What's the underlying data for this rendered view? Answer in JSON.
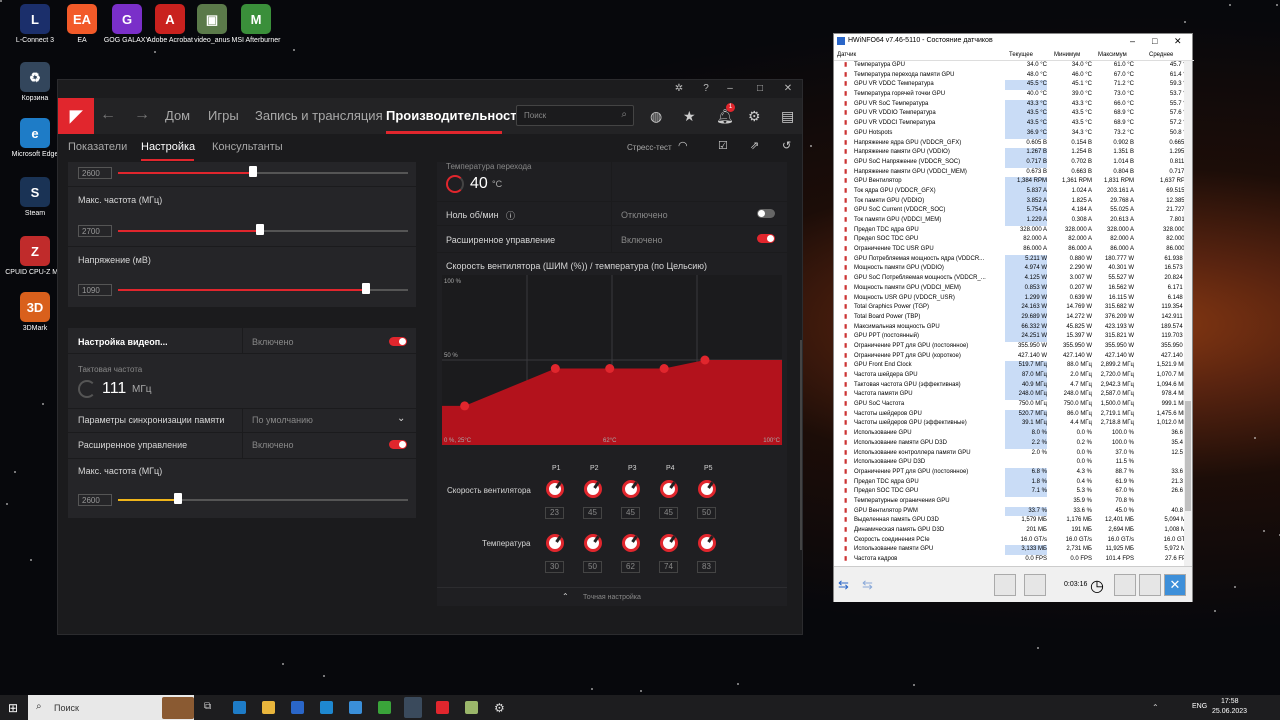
{
  "desktop": {
    "icons": [
      {
        "label": "L-Connect 3",
        "color": "#1b2f6b",
        "glyph": "L"
      },
      {
        "label": "EA",
        "color": "#f25a29",
        "glyph": "EA"
      },
      {
        "label": "GOG GALAXY",
        "color": "#7a2fc9",
        "glyph": "G"
      },
      {
        "label": "Adobe Acrobat",
        "color": "#c9211e",
        "glyph": "A"
      },
      {
        "label": "video_anus",
        "color": "#5b7a4a",
        "glyph": "▣"
      },
      {
        "label": "MSI Afterburner",
        "color": "#3a8f3a",
        "glyph": "M"
      },
      {
        "label": "Корзина",
        "color": "#33465c",
        "glyph": "♻"
      },
      {
        "label": "Microsoft Edge",
        "color": "#1e7cc7",
        "glyph": "e"
      },
      {
        "label": "Steam",
        "color": "#1a3355",
        "glyph": "S"
      },
      {
        "label": "CPUID CPU-Z MSI",
        "color": "#c02b2b",
        "glyph": "Z"
      },
      {
        "label": "3DMark",
        "color": "#d9601c",
        "glyph": "3D"
      }
    ]
  },
  "amd": {
    "nav": {
      "home": "Дом",
      "games": "Игры",
      "record": "Запись и трансляция",
      "performance": "Производительность",
      "search_placeholder": "Поиск",
      "notif_count": "1"
    },
    "subnav": {
      "metrics": "Показатели",
      "tuning": "Настройка",
      "advisors": "Консультанты",
      "stress": "Стресс-тест"
    },
    "gpu": {
      "freq_min_value": "2600",
      "max_freq_label": "Макс. частота (МГц)",
      "max_freq_value": "2700",
      "voltage_label": "Напряжение (мВ)",
      "voltage_value": "1090"
    },
    "vram": {
      "title": "Настройка видеоп...",
      "title_state": "Включено",
      "clock_label": "Тактовая частота",
      "clock_value": "111",
      "clock_unit": "МГц",
      "mem_timing_label": "Параметры синхронизации памяти",
      "mem_timing_value": "По умолчанию",
      "advanced_label": "Расширенное управление",
      "advanced_state": "Включено",
      "max_freq_label": "Макс. частота (МГц)",
      "max_freq_value": "2600"
    },
    "fan": {
      "junction_label": "Температура перехода",
      "junction_value": "40",
      "junction_unit": "°C",
      "zero_rpm_label": "Ноль об/мин",
      "zero_rpm_state": "Отключено",
      "advanced_label": "Расширенное управление",
      "advanced_state": "Включено",
      "curve_title": "Скорость вентилятора (ШИМ (%)) / температура (по Цельсию)",
      "axis_top": "100 %",
      "axis_mid": "50 %",
      "axis_origin": "0 %, 25°C",
      "axis_mid_x": "62°C",
      "axis_end": "100°C",
      "speed_label": "Скорость вентилятора",
      "temp_label": "Температура",
      "fine_tune": "Точная настройка",
      "points": [
        {
          "p": "P1",
          "speed": "23",
          "temp": "30"
        },
        {
          "p": "P2",
          "speed": "45",
          "temp": "50"
        },
        {
          "p": "P3",
          "speed": "45",
          "temp": "62"
        },
        {
          "p": "P4",
          "speed": "45",
          "temp": "74"
        },
        {
          "p": "P5",
          "speed": "50",
          "temp": "83"
        }
      ]
    }
  },
  "hwinfo": {
    "title": "HWiNFO64 v7.46-5110 - Состояние датчиков",
    "cols": [
      "Датчик",
      "Текущее",
      "Минимум",
      "Максимум",
      "Среднее"
    ],
    "elapsed": "0:03:16",
    "rows": [
      [
        "Температура GPU",
        "34.0 °C",
        "34.0 °C",
        "61.0 °C",
        "45.7 °C",
        0
      ],
      [
        "Температура перехода памяти GPU",
        "48.0 °C",
        "46.0 °C",
        "67.0 °C",
        "61.4 °C",
        0
      ],
      [
        "GPU VR VDDC Температура",
        "45.5 °C",
        "45.1 °C",
        "71.2 °C",
        "59.3 °C",
        1
      ],
      [
        "Температура горячей точки GPU",
        "40.0 °C",
        "39.0 °C",
        "73.0 °C",
        "53.7 °C",
        0
      ],
      [
        "GPU VR SoC Температура",
        "43.3 °C",
        "43.3 °C",
        "66.0 °C",
        "55.7 °C",
        1
      ],
      [
        "GPU VR VDDIO Температура",
        "43.5 °C",
        "43.5 °C",
        "68.9 °C",
        "57.6 °C",
        1
      ],
      [
        "GPU VR VDDCI Температура",
        "43.5 °C",
        "43.5 °C",
        "68.9 °C",
        "57.2 °C",
        1
      ],
      [
        "GPU Hotspots",
        "36.9 °C",
        "34.3 °C",
        "73.2 °C",
        "50.8 °C",
        1
      ],
      [
        "Напряжение ядра GPU (VDDCR_GFX)",
        "0.605 В",
        "0.154 В",
        "0.902 В",
        "0.665 В",
        0
      ],
      [
        "Напряжение памяти GPU (VDDIO)",
        "1.267 В",
        "1.254 В",
        "1.351 В",
        "1.295 В",
        1
      ],
      [
        "GPU SoC Напряжение (VDDCR_SOC)",
        "0.717 В",
        "0.702 В",
        "1.014 В",
        "0.811 В",
        1
      ],
      [
        "Напряжение памяти GPU (VDDCI_MEM)",
        "0.673 В",
        "0.663 В",
        "0.804 В",
        "0.717 В",
        0
      ],
      [
        "GPU Вентилятор",
        "1,384 RPM",
        "1,361 RPM",
        "1,831 RPM",
        "1,637 RPM",
        1
      ],
      [
        "Ток ядра GPU (VDDCR_GFX)",
        "5.837 A",
        "1.024 A",
        "203.161 A",
        "69.515 A",
        1
      ],
      [
        "Ток памяти GPU (VDDIO)",
        "3.852 A",
        "1.825 A",
        "29.768 A",
        "12.385 A",
        1
      ],
      [
        "GPU SoC Current (VDDCR_SOC)",
        "5.754 A",
        "4.184 A",
        "55.025 A",
        "21.727 A",
        1
      ],
      [
        "Ток памяти GPU (VDDCI_MEM)",
        "1.229 A",
        "0.308 A",
        "20.613 A",
        "7.801 A",
        1
      ],
      [
        "Предел TDC ядра GPU",
        "328.000 A",
        "328.000 A",
        "328.000 A",
        "328.000 A",
        0
      ],
      [
        "Предел SOC TDC GPU",
        "82.000 A",
        "82.000 A",
        "82.000 A",
        "82.000 A",
        0
      ],
      [
        "Ограничение TDC USR GPU",
        "86.000 A",
        "86.000 A",
        "86.000 A",
        "86.000 A",
        0
      ],
      [
        "GPU Потребляемая мощность ядра (VDDCR...",
        "5.211 W",
        "0.880 W",
        "180.777 W",
        "61.938 W",
        1
      ],
      [
        "Мощность памяти GPU (VDDIO)",
        "4.974 W",
        "2.290 W",
        "40.301 W",
        "16.573 W",
        1
      ],
      [
        "GPU SoC Потребляемая мощность (VDDCR_...",
        "4.125 W",
        "3.007 W",
        "55.527 W",
        "20.824 W",
        1
      ],
      [
        "Мощность памяти GPU (VDDCI_MEM)",
        "0.853 W",
        "0.207 W",
        "16.562 W",
        "6.171 W",
        1
      ],
      [
        "Мощность USR GPU (VDDCR_USR)",
        "1.299 W",
        "0.639 W",
        "16.115 W",
        "6.148 W",
        1
      ],
      [
        "Total Graphics Power (TGP)",
        "24.163 W",
        "14.769 W",
        "315.682 W",
        "119.354 W",
        1
      ],
      [
        "Total Board Power (TBP)",
        "29.689 W",
        "14.272 W",
        "376.209 W",
        "142.911 W",
        1
      ],
      [
        "Максимальная мощность GPU",
        "66.332 W",
        "45.825 W",
        "423.193 W",
        "189.574 W",
        1
      ],
      [
        "GPU PPT (постоянный)",
        "24.251 W",
        "15.397 W",
        "315.821 W",
        "119.703 W",
        1
      ],
      [
        "Ограничение PPT для GPU (постоянное)",
        "355.950 W",
        "355.950 W",
        "355.950 W",
        "355.950 W",
        0
      ],
      [
        "Ограничение PPT для GPU (короткое)",
        "427.140 W",
        "427.140 W",
        "427.140 W",
        "427.140 W",
        0
      ],
      [
        "GPU Front End Clock",
        "519.7 МГц",
        "88.0 МГц",
        "2,899.2 МГц",
        "1,521.9 МГц",
        1
      ],
      [
        "Частота шейдера GPU",
        "87.0 МГц",
        "2.0 МГц",
        "2,720.0 МГц",
        "1,070.7 МГц",
        1
      ],
      [
        "Тактовая частота GPU (эффективная)",
        "40.9 МГц",
        "4.7 МГц",
        "2,942.3 МГц",
        "1,094.6 МГц",
        1
      ],
      [
        "Частота памяти GPU",
        "248.0 МГц",
        "248.0 МГц",
        "2,587.0 МГц",
        "978.4 МГц",
        1
      ],
      [
        "GPU SoC Частота",
        "750.0 МГц",
        "750.0 МГц",
        "1,500.0 МГц",
        "999.1 МГц",
        0
      ],
      [
        "Частоты шейдеров GPU",
        "520.7 МГц",
        "86.0 МГц",
        "2,719.1 МГц",
        "1,475.6 МГц",
        1
      ],
      [
        "Частоты шейдеров GPU (эффективные)",
        "39.1 МГц",
        "4.4 МГц",
        "2,718.8 МГц",
        "1,012.0 МГц",
        1
      ],
      [
        "Использование GPU",
        "8.0 %",
        "0.0 %",
        "100.0 %",
        "36.6 %",
        1
      ],
      [
        "Использование памяти GPU D3D",
        "2.2 %",
        "0.2 %",
        "100.0 %",
        "35.4 %",
        1
      ],
      [
        "Использование контроллера памяти GPU",
        "2.0 %",
        "0.0 %",
        "37.0 %",
        "12.5 %",
        0
      ],
      [
        "Использование GPU D3D",
        "",
        "0.0 %",
        "11.5 %",
        "",
        0
      ],
      [
        "Ограничение PPT для GPU (постоянное)",
        "6.8 %",
        "4.3 %",
        "88.7 %",
        "33.6 %",
        1
      ],
      [
        "Предел TDC ядра GPU",
        "1.8 %",
        "0.4 %",
        "61.9 %",
        "21.3 %",
        1
      ],
      [
        "Предел SOC TDC GPU",
        "7.1 %",
        "5.3 %",
        "67.0 %",
        "26.6 %",
        1
      ],
      [
        "Температурные ограничения GPU",
        "",
        "35.9 %",
        "70.8 %",
        "",
        0
      ],
      [
        "GPU Вентилятор PWM",
        "33.7 %",
        "33.6 %",
        "45.0 %",
        "40.8 %",
        1
      ],
      [
        "Выделенная память GPU D3D",
        "1,579 МБ",
        "1,176 МБ",
        "12,401 МБ",
        "5,094 МБ",
        0
      ],
      [
        "Динамическая память GPU D3D",
        "201 МБ",
        "191 МБ",
        "2,694 МБ",
        "1,008 МБ",
        0
      ],
      [
        "Скорость соединения PCIe",
        "16.0 GT/s",
        "16.0 GT/s",
        "16.0 GT/s",
        "16.0 GT/s",
        0
      ],
      [
        "Использование памяти GPU",
        "3,133 МБ",
        "2,731 МБ",
        "11,925 МБ",
        "5,972 МБ",
        1
      ],
      [
        "Частота кадров",
        "0.0 FPS",
        "0.0 FPS",
        "101.4 FPS",
        "27.6 FPS",
        0
      ]
    ]
  },
  "taskbar": {
    "search": "Поиск",
    "lang": "ENG",
    "time": "17:58",
    "date": "25.06.2023"
  }
}
